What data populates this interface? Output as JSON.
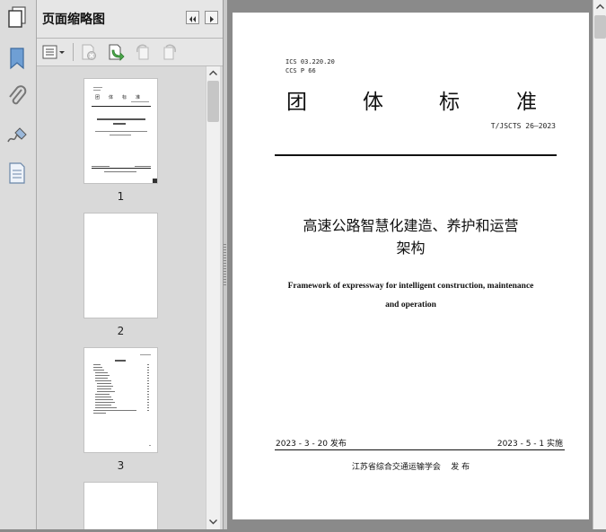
{
  "panel": {
    "title": "页面缩略图",
    "thumbnails": [
      {
        "page_number": "1"
      },
      {
        "page_number": "2"
      },
      {
        "page_number": "3"
      }
    ]
  },
  "document": {
    "ics": "ICS 03.220.20",
    "ccs": "CCS P 66",
    "standard_type_chars": [
      "团",
      "体",
      "标",
      "准"
    ],
    "standard_code": "T/JSCTS 26—2023",
    "title_cn_line1": "高速公路智慧化建造、养护和运营",
    "title_cn_line2": "架构",
    "title_en_line1": "Framework of expressway for intelligent construction, maintenance",
    "title_en_line2": "and operation",
    "release_date": "2023 - 3 - 20 发布",
    "implement_date": "2023 - 5 - 1 实施",
    "issuer": "江苏省综合交通运输学会    发 布"
  }
}
